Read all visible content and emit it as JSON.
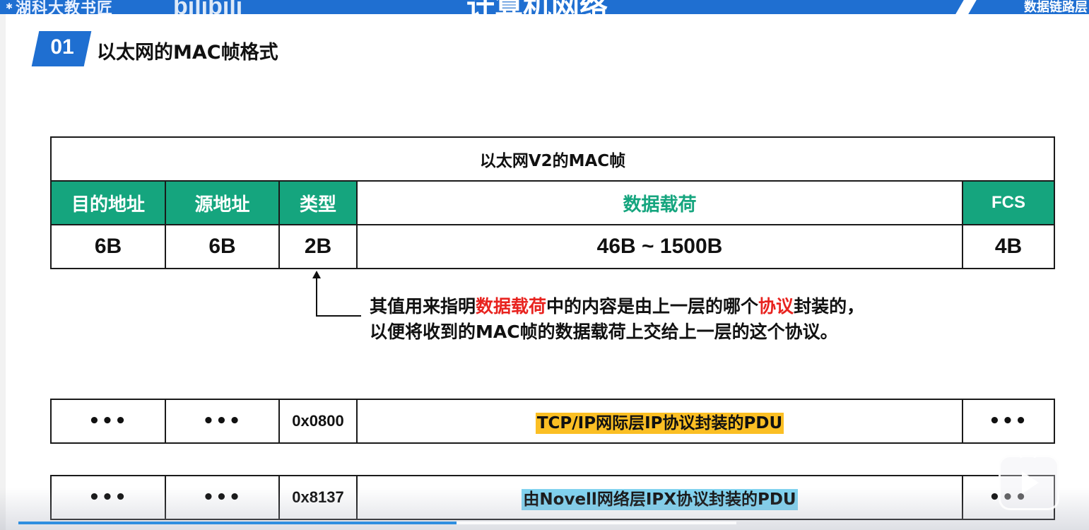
{
  "banner": {
    "watermark": "湖科大教书匠",
    "brand": "bilibili",
    "title": "计算机网络",
    "chapter": "数据链路层"
  },
  "section": {
    "number": "01",
    "title": "以太网的MAC帧格式"
  },
  "frame": {
    "caption": "以太网V2的MAC帧",
    "headers": [
      "目的地址",
      "源地址",
      "类型",
      "数据载荷",
      "FCS"
    ],
    "sizes": [
      "6B",
      "6B",
      "2B",
      "46B ~ 1500B",
      "4B"
    ]
  },
  "annotation": {
    "line1_a": "其值用来指明",
    "line1_red1": "数据载荷",
    "line1_b": "中的内容是由上一层的哪个",
    "line1_red2": "协议",
    "line1_c": "封装的，",
    "line2": "以便将收到的MAC帧的数据载荷上交给上一层的这个协议。"
  },
  "examples": [
    {
      "dst": "•••",
      "src": "•••",
      "type": "0x0800",
      "payload": "TCP/IP网际层IP协议封装的PDU",
      "fcs": "•••"
    },
    {
      "dst": "•••",
      "src": "•••",
      "type": "0x8137",
      "payload": "由Novell网络层IPX协议封装的PDU",
      "fcs": "•••"
    }
  ],
  "player": {
    "progress_percent": 61
  },
  "colors": {
    "banner_blue": "#1f6fd1",
    "header_green": "#15a57e",
    "highlight_red": "#e8231f",
    "highlight_yellow": "#fbbf24",
    "highlight_cyan": "#7fd3f0",
    "progress_blue": "#2f8fe0"
  },
  "icons": {
    "play": "play-icon"
  }
}
